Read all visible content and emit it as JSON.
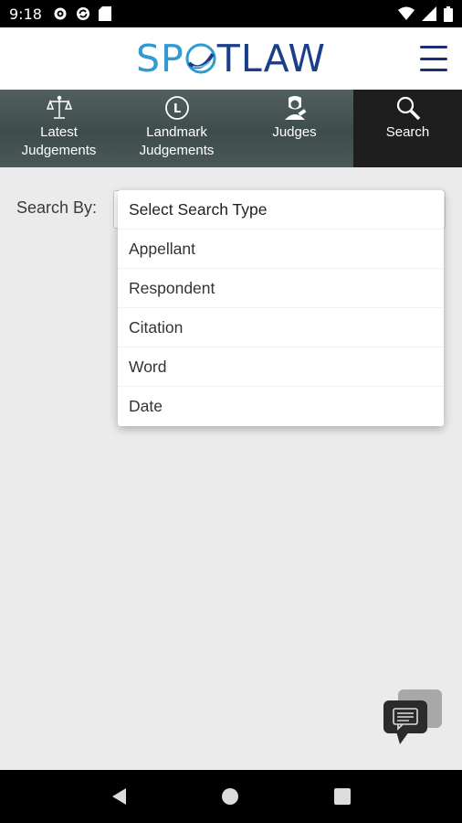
{
  "status_bar": {
    "time": "9:18"
  },
  "app": {
    "logo_part1": "SP",
    "logo_part2": "TLAW"
  },
  "nav_tabs": [
    {
      "line1": "Latest",
      "line2": "Judgements",
      "icon": "scales-icon"
    },
    {
      "line1": "Landmark",
      "line2": "Judgements",
      "icon": "landmark-l-icon"
    },
    {
      "line1": "Judges",
      "line2": "",
      "icon": "judge-icon"
    },
    {
      "line1": "Search",
      "line2": "",
      "icon": "search-icon",
      "active": true
    }
  ],
  "search": {
    "label": "Search By:",
    "options": [
      "Select Search Type",
      "Appellant",
      "Respondent",
      "Citation",
      "Word",
      "Date"
    ]
  },
  "colors": {
    "accent_light": "#2f9bd1",
    "accent_dark": "#1a3f8a",
    "nav_bg": "#4a5857",
    "active_tab": "#1e1e1e"
  }
}
